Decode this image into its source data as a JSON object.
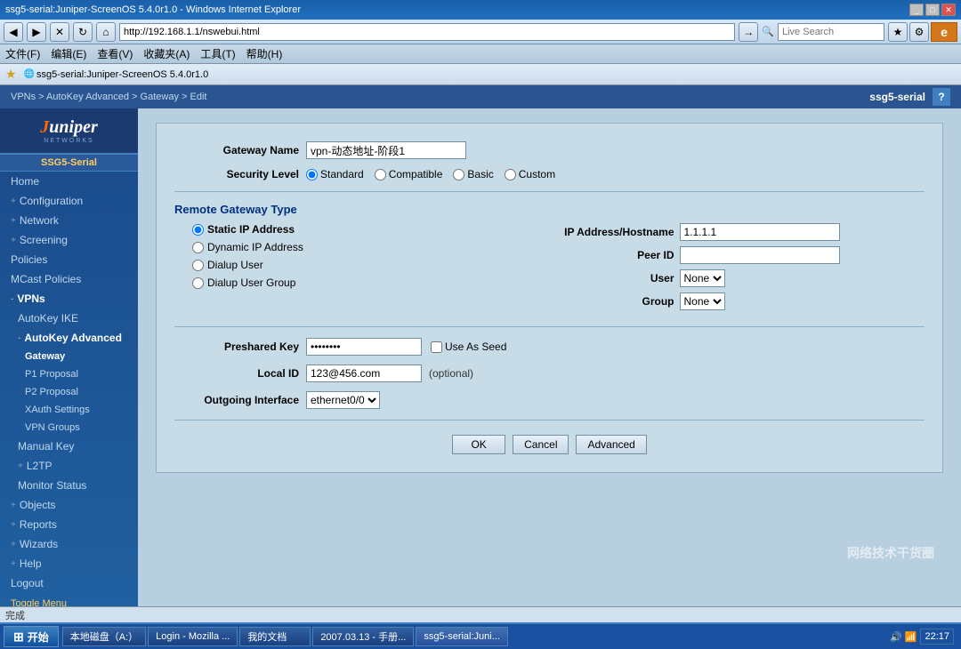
{
  "browser": {
    "title": "ssg5-serial:Juniper-ScreenOS 5.4.0r1.0 - Windows Internet Explorer",
    "address": "http://192.168.1.1/nswebui.html",
    "search_placeholder": "Live Search",
    "menus": [
      "文件(F)",
      "编辑(E)",
      "查看(V)",
      "收藏夹(A)",
      "工具(T)",
      "帮助(H)"
    ],
    "bookmark_label": "ssg5-serial:Juniper-ScreenOS 5.4.0r1.0",
    "status": "完成"
  },
  "page": {
    "breadcrumb": "VPNs > AutoKey Advanced > Gateway > Edit",
    "device": "ssg5-serial",
    "help_icon": "?"
  },
  "sidebar": {
    "logo_text": "Juniper",
    "logo_sub": "NETWORKS",
    "device_label": "SSG5-Serial",
    "items": [
      {
        "label": "Home",
        "level": 0,
        "expandable": false
      },
      {
        "label": "Configuration",
        "level": 0,
        "expandable": true
      },
      {
        "label": "Network",
        "level": 0,
        "expandable": true
      },
      {
        "label": "Screening",
        "level": 0,
        "expandable": true
      },
      {
        "label": "Policies",
        "level": 0,
        "expandable": false
      },
      {
        "label": "MCast Policies",
        "level": 0,
        "expandable": false
      },
      {
        "label": "VPNs",
        "level": 0,
        "expandable": true,
        "active": true
      },
      {
        "label": "AutoKey IKE",
        "level": 1,
        "expandable": false
      },
      {
        "label": "AutoKey Advanced",
        "level": 1,
        "expandable": true,
        "active": true
      },
      {
        "label": "Gateway",
        "level": 2,
        "expandable": false,
        "active": true
      },
      {
        "label": "P1 Proposal",
        "level": 2,
        "expandable": false
      },
      {
        "label": "P2 Proposal",
        "level": 2,
        "expandable": false
      },
      {
        "label": "XAuth Settings",
        "level": 2,
        "expandable": false
      },
      {
        "label": "VPN Groups",
        "level": 2,
        "expandable": false
      },
      {
        "label": "Manual Key",
        "level": 1,
        "expandable": false
      },
      {
        "label": "L2TP",
        "level": 1,
        "expandable": true
      },
      {
        "label": "Monitor Status",
        "level": 1,
        "expandable": false
      },
      {
        "label": "Objects",
        "level": 0,
        "expandable": true
      },
      {
        "label": "Reports",
        "level": 0,
        "expandable": true
      },
      {
        "label": "Wizards",
        "level": 0,
        "expandable": true
      },
      {
        "label": "Help",
        "level": 0,
        "expandable": true
      },
      {
        "label": "Logout",
        "level": 0,
        "expandable": false
      }
    ],
    "toggle_menu": "Toggle Menu"
  },
  "form": {
    "gateway_name_label": "Gateway Name",
    "gateway_name_value": "vpn-动态地址-阶段1",
    "security_level_label": "Security Level",
    "security_options": [
      "Standard",
      "Compatible",
      "Basic",
      "Custom"
    ],
    "security_selected": "Standard",
    "remote_gateway_type_label": "Remote Gateway Type",
    "radio_options": [
      {
        "label": "Static IP Address",
        "selected": true
      },
      {
        "label": "Dynamic IP Address",
        "selected": false
      },
      {
        "label": "Dialup User",
        "selected": false
      },
      {
        "label": "Dialup User Group",
        "selected": false
      }
    ],
    "ip_hostname_label": "IP Address/Hostname",
    "ip_hostname_value": "1.1.1.1",
    "peer_id_label": "Peer ID",
    "peer_id_value": "",
    "user_label": "User",
    "user_value": "None",
    "group_label": "Group",
    "group_value": "None",
    "preshared_key_label": "Preshared Key",
    "preshared_key_value": "••••••••",
    "use_as_seed_label": "Use As Seed",
    "local_id_label": "Local ID",
    "local_id_value": "123@456.com",
    "optional_label": "(optional)",
    "outgoing_interface_label": "Outgoing Interface",
    "outgoing_interface_value": "ethernet0/0",
    "ok_label": "OK",
    "cancel_label": "Cancel",
    "advanced_label": "Advanced"
  },
  "taskbar": {
    "start_label": "开始",
    "items": [
      "本地磁盘（A:）",
      "Login - Mozilla ...",
      "我的文档",
      "2007.03.13 - 手册...",
      "ssg5-serial:Juni..."
    ],
    "time": "22:17"
  }
}
